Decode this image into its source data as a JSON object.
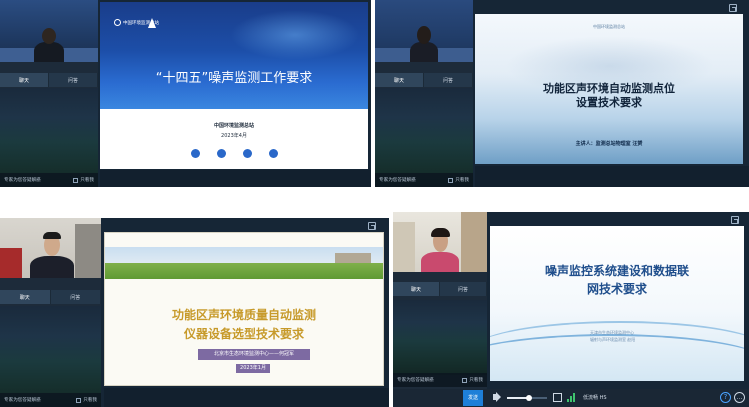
{
  "common": {
    "tab_chat": "聊天",
    "tab_qa": "问答",
    "footer_left": "专家为您答疑解惑",
    "footer_right": "只看我"
  },
  "panel1": {
    "slide_org": "中国环境监测总站",
    "slide_title": "“十四五”噪声监测工作要求",
    "slide_sub": "中国环境监测总站",
    "slide_date": "2023年4月",
    "icons": [
      "sun-icon",
      "leaf-icon",
      "water-icon",
      "earth-icon"
    ]
  },
  "panel2": {
    "slide_org": "中国环境监测总站",
    "slide_title_line1": "功能区声环境自动监测点位",
    "slide_title_line2": "设置技术要求",
    "slide_speaker": "主讲人：监测总站物理室  汪赟"
  },
  "panel3": {
    "slide_title_line1": "功能区声环境质量自动监测",
    "slide_title_line2": "仪器设备选型技术要求",
    "slide_sub": "北京市生态环境监测中心——何冠军",
    "slide_date": "2023年1月"
  },
  "panel4": {
    "slide_title_line1": "噪声监控系统建设和数据联",
    "slide_title_line2": "网技术要求",
    "slide_sub1": "天津市生态环境监测中心",
    "slide_sub2": "辐射与声环境监测室 赵阳",
    "send_label": "发送",
    "speed_label": "低流畅 HS",
    "volume_level": 0.55,
    "colors": {
      "send": "#1e7fd8"
    }
  }
}
